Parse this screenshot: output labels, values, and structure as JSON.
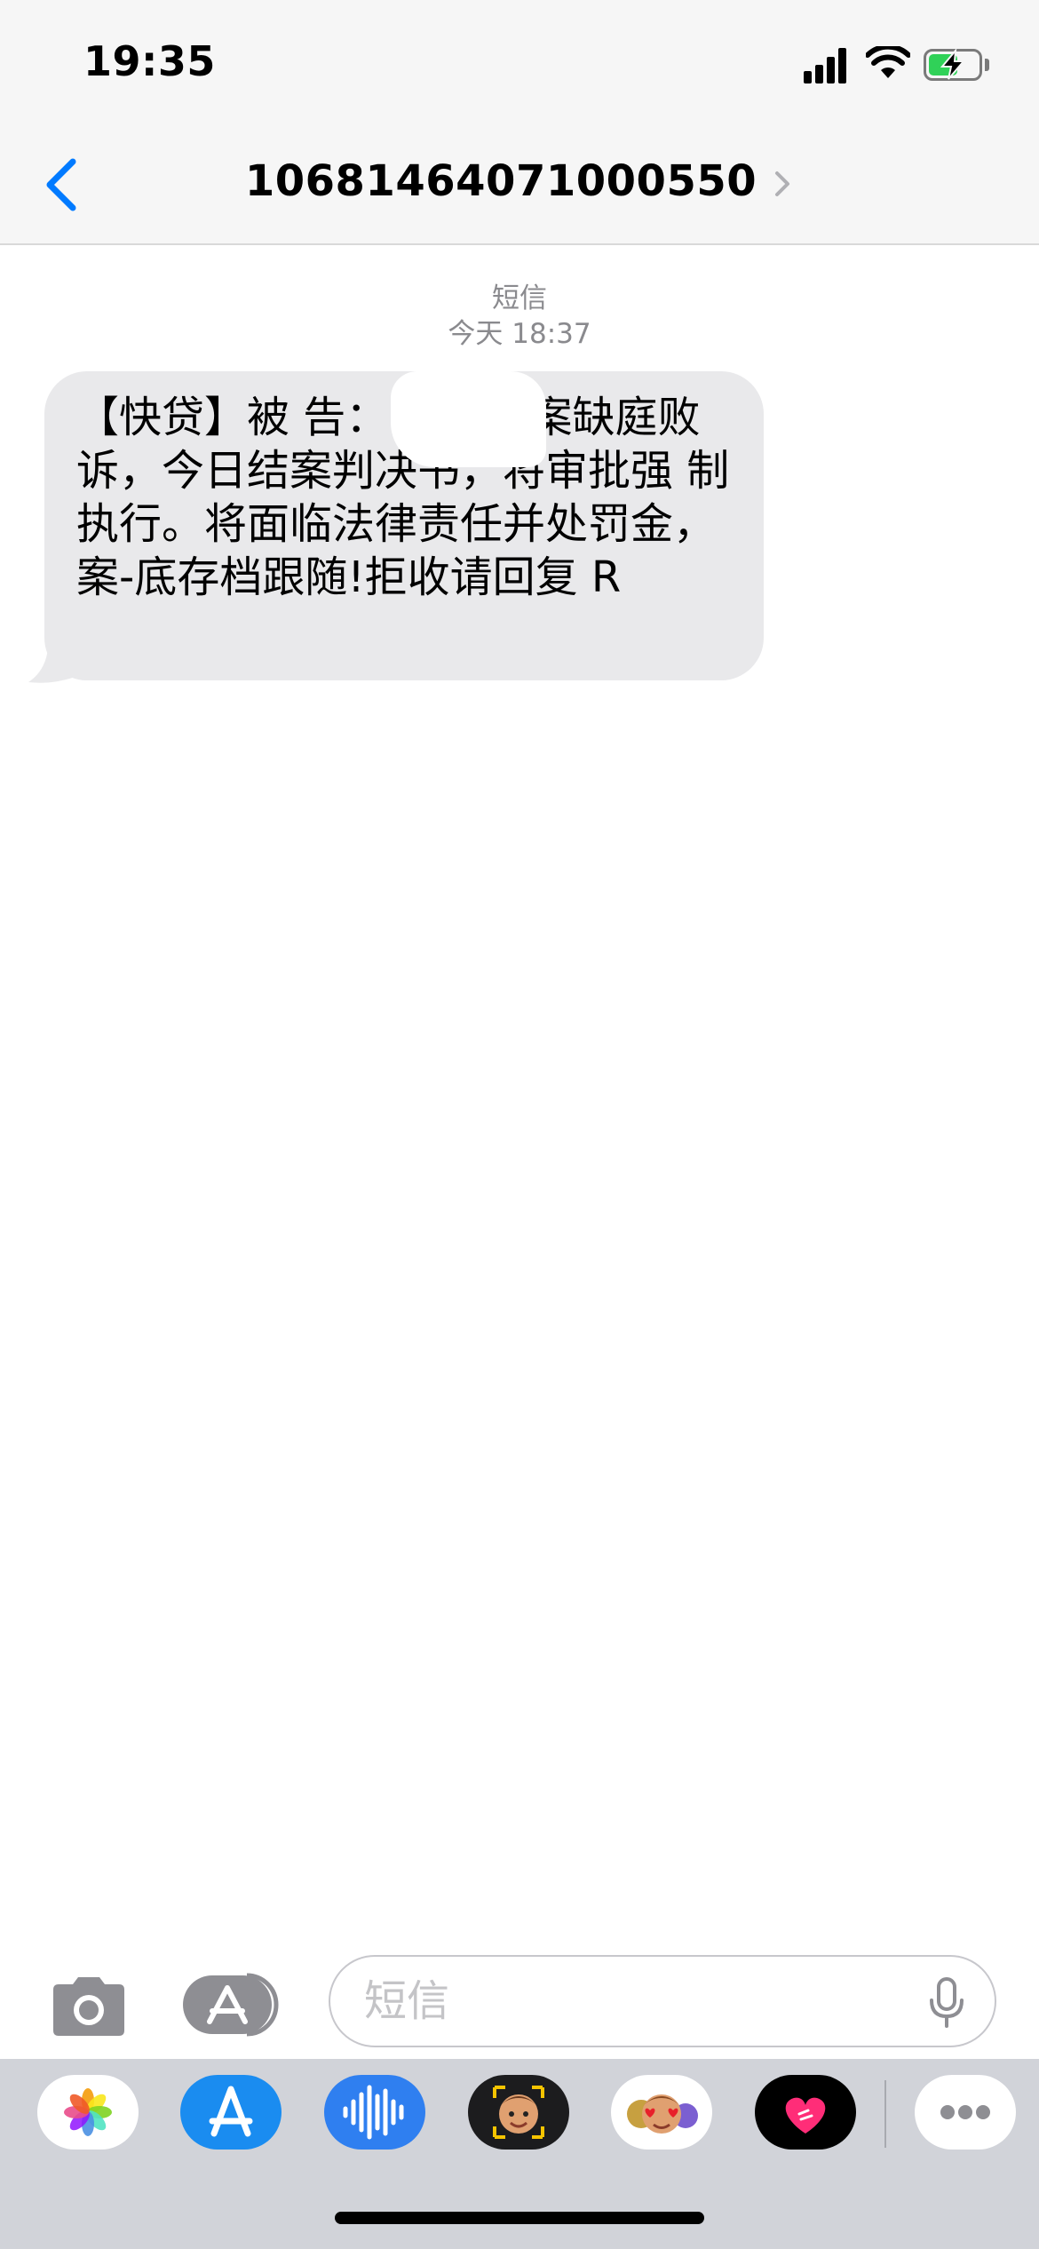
{
  "status_bar": {
    "time": "19:35"
  },
  "header": {
    "title": "10681464071000550"
  },
  "conversation": {
    "service_label": "短信",
    "timestamp": "今天 18:37",
    "message_text": "【快贷】被 告：       因支付案缺庭败诉，今日结案判决书，将审批强 制执行。将面临法律责任并处罚金，案-底存档跟随!拒收请回复 R"
  },
  "input": {
    "placeholder": "短信"
  },
  "app_strip": {
    "apps": [
      "photos-icon",
      "app-store-icon",
      "audio-message-icon",
      "memoji-icon",
      "animoji-stickers-icon",
      "digital-touch-icon",
      "more-icon"
    ]
  },
  "colors": {
    "accent": "#007aff",
    "bubble_gray": "#e9e9eb",
    "battery_green": "#30d158"
  }
}
